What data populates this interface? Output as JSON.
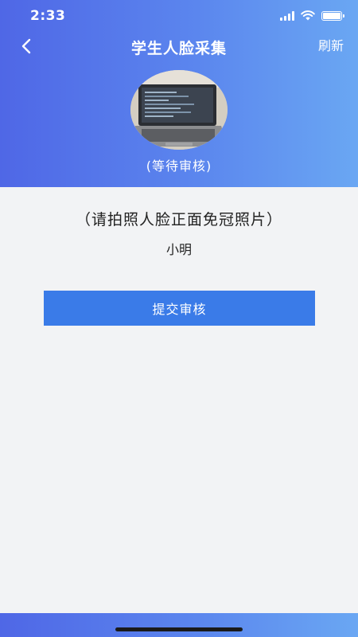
{
  "status_bar": {
    "time": "2:33"
  },
  "nav": {
    "title": "学生人脸采集",
    "refresh_label": "刷新",
    "back_icon": "chevron-left-icon"
  },
  "profile": {
    "review_status": "(等待审核)"
  },
  "main": {
    "hint": "（请拍照人脸正面免冠照片）",
    "student_name": "小明",
    "submit_label": "提交审核"
  },
  "colors": {
    "header_gradient_start": "#4f67e6",
    "header_gradient_end": "#6aa7f3",
    "primary_button": "#3a7be8",
    "page_background": "#f2f3f5"
  }
}
